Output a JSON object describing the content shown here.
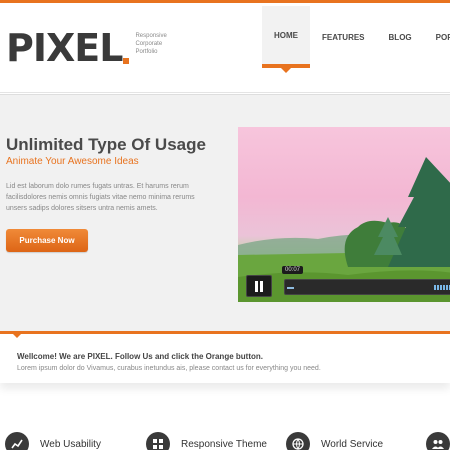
{
  "brand": {
    "logo": "PIXEL",
    "tagline": [
      "Responsive",
      "Corporate",
      "Portfolio"
    ],
    "accent_color": "#e8731f"
  },
  "nav": {
    "items": [
      {
        "label": "HOME",
        "active": true
      },
      {
        "label": "FEATURES",
        "active": false
      },
      {
        "label": "BLOG",
        "active": false
      },
      {
        "label": "PORTF",
        "active": false
      }
    ]
  },
  "hero": {
    "title": "Unlimited Type Of Usage",
    "subtitle": "Animate Your Awesome Ideas",
    "body": "Lid est laborum dolo rumes fugats untras. Et harums rerum facilisdolores nemis omnis fugiats vitae nemo minima rerums unsers sadips dolores sitsers untra nemis amets.",
    "button_label": "Purchase Now"
  },
  "video": {
    "time": "00:07",
    "progress": 0.04,
    "play_icon": "pause-icon"
  },
  "welcome": {
    "title": "Wellcome! We are PIXEL. Follow Us and click the Orange button.",
    "text": "Lorem ipsum dolor do Vivamus, curabus inetundus ais, please contact us for everything you need."
  },
  "features": [
    {
      "label": "Web Usability",
      "icon": "chart-icon"
    },
    {
      "label": "Responsive Theme",
      "icon": "grid-icon"
    },
    {
      "label": "World Service",
      "icon": "globe-icon"
    },
    {
      "label": "",
      "icon": "people-icon"
    }
  ]
}
